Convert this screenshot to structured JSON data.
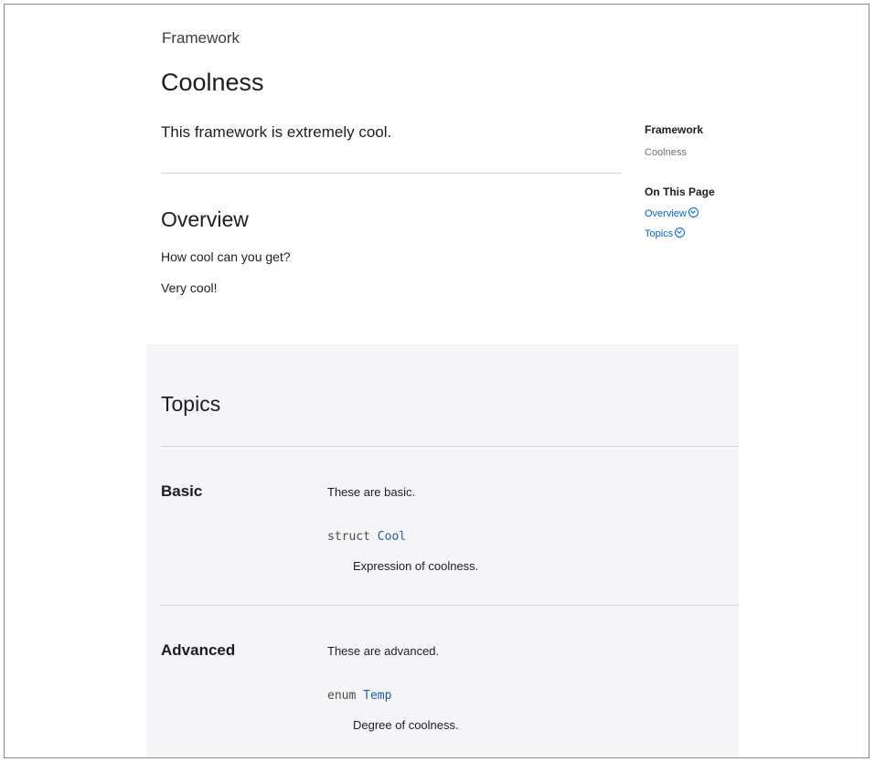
{
  "header": {
    "eyebrow": "Framework",
    "title": "Coolness",
    "abstract": "This framework is extremely cool."
  },
  "overview": {
    "heading": "Overview",
    "paragraphs": [
      "How cool can you get?",
      "Very cool!"
    ]
  },
  "sidebar": {
    "label": "Framework",
    "crumb": "Coolness",
    "on_this_page_label": "On This Page",
    "links": [
      {
        "label": "Overview",
        "icon": "chevron-circle-down-icon"
      },
      {
        "label": "Topics",
        "icon": "chevron-circle-down-icon"
      }
    ]
  },
  "topics": {
    "heading": "Topics",
    "groups": [
      {
        "title": "Basic",
        "abstract": "These are basic.",
        "declaration": {
          "keyword": "struct",
          "symbol": "Cool"
        },
        "description": "Expression of coolness."
      },
      {
        "title": "Advanced",
        "abstract": "These are advanced.",
        "declaration": {
          "keyword": "enum",
          "symbol": "Temp"
        },
        "description": "Degree of coolness."
      }
    ]
  },
  "colors": {
    "link": "#0066cc",
    "topics_background": "#f5f5f7",
    "divider": "#d2d2d7"
  }
}
